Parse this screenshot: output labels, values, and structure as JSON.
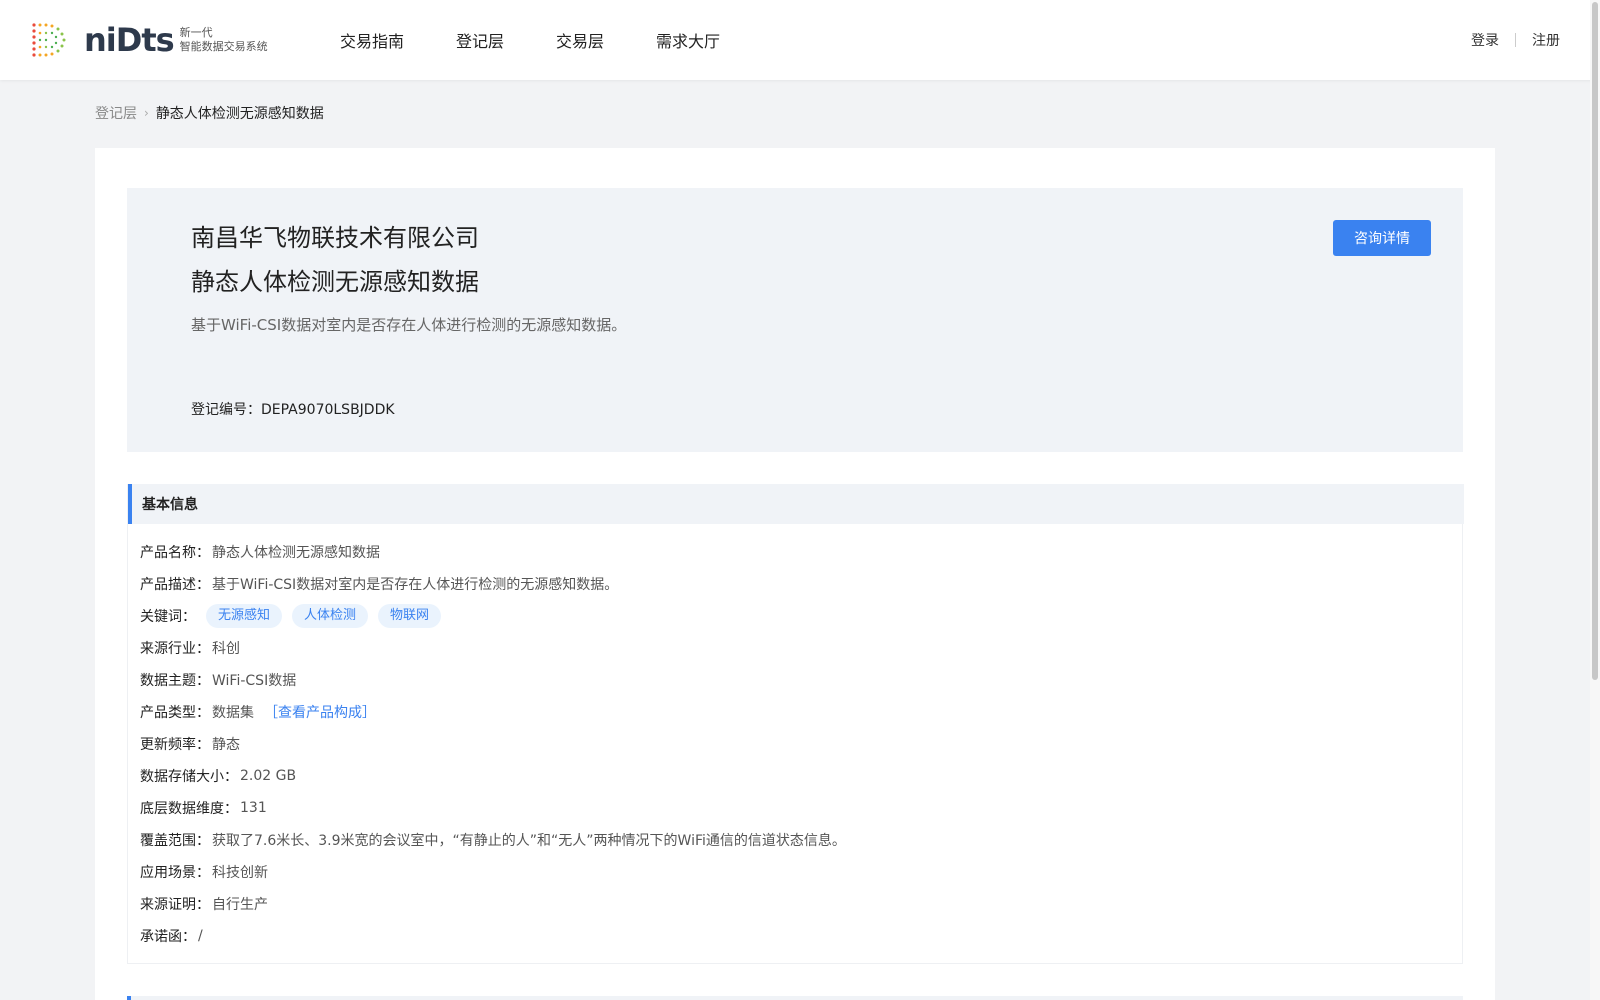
{
  "header": {
    "logo_word": "niDts",
    "logo_line1": "新一代",
    "logo_line2": "智能数据交易系统",
    "nav": [
      {
        "label": "交易指南"
      },
      {
        "label": "登记层"
      },
      {
        "label": "交易层"
      },
      {
        "label": "需求大厅"
      }
    ],
    "login": "登录",
    "register": "注册"
  },
  "breadcrumb": {
    "parent": "登记层",
    "separator": "›",
    "current": "静态人体检测无源感知数据"
  },
  "hero": {
    "company": "南昌华飞物联技术有限公司",
    "product": "静态人体检测无源感知数据",
    "description": "基于WiFi-CSI数据对室内是否存在人体进行检测的无源感知数据。",
    "reg_label": "登记编号：",
    "reg_value": "DEPA9070LSBJDDK",
    "consult_button": "咨询详情"
  },
  "basic_info": {
    "title": "基本信息",
    "name": {
      "label": "产品名称：",
      "value": "静态人体检测无源感知数据"
    },
    "desc": {
      "label": "产品描述：",
      "value": "基于WiFi-CSI数据对室内是否存在人体进行检测的无源感知数据。"
    },
    "keywords": {
      "label": "关键词：",
      "tags": [
        "无源感知",
        "人体检测",
        "物联网"
      ]
    },
    "industry": {
      "label": "来源行业：",
      "value": "科创"
    },
    "theme": {
      "label": "数据主题：",
      "value": "WiFi-CSI数据"
    },
    "type": {
      "label": "产品类型：",
      "value": "数据集",
      "link": "［查看产品构成］"
    },
    "frequency": {
      "label": "更新频率：",
      "value": "静态"
    },
    "storage": {
      "label": "数据存储大小：",
      "value": "2.02 GB"
    },
    "dimension": {
      "label": "底层数据维度：",
      "value": "131"
    },
    "coverage": {
      "label": "覆盖范围：",
      "value": "获取了7.6米长、3.9米宽的会议室中，“有静止的人”和“无人”两种情况下的WiFi通信的信道状态信息。"
    },
    "scenario": {
      "label": "应用场景：",
      "value": "科技创新"
    },
    "source_proof": {
      "label": "来源证明：",
      "value": "自行生产"
    },
    "commitment": {
      "label": "承诺函：",
      "value": "/"
    }
  },
  "colors": {
    "accent": "#3a82f0",
    "tag_bg": "#eaf3fd",
    "panel_bg": "#f0f3f7"
  }
}
